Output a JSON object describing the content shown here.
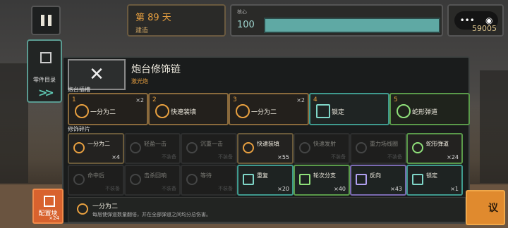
{
  "hud": {
    "day_label": "第 89 天",
    "phase_label": "建造",
    "core_label": "核心",
    "core_value": "100",
    "core_fill": 1.0,
    "coins": "59005"
  },
  "sidebar": {
    "parts_catalog_label": "零件目录",
    "core_block_label": "配置块",
    "core_block_count": "×24"
  },
  "right_button": {
    "label": "议"
  },
  "modal": {
    "title": "炮台修饰链",
    "subtitle": "激光炮",
    "slots_header": "炮台插槽",
    "fragments_header": "修饰碎片",
    "slots": [
      {
        "num": "1",
        "label": "一分为二",
        "count": "×2"
      },
      {
        "num": "2",
        "label": "快速装填",
        "count": ""
      },
      {
        "num": "3",
        "label": "一分为二",
        "count": "×2"
      },
      {
        "num": "4",
        "label": "锁定",
        "count": ""
      },
      {
        "num": "5",
        "label": "蛇形弹道",
        "count": ""
      }
    ],
    "fragments_row1": [
      {
        "label": "一分为二",
        "count": "×4"
      },
      {
        "label": "轻盈一击",
        "count": "不装备"
      },
      {
        "label": "沉重一击",
        "count": "不装备"
      },
      {
        "label": "快速装填",
        "count": "×55"
      },
      {
        "label": "快速发射",
        "count": "不装备"
      },
      {
        "label": "重力场线圈",
        "count": "不装备"
      },
      {
        "label": "蛇形弹道",
        "count": "×24"
      }
    ],
    "fragments_row2": [
      {
        "label": "命中后",
        "count": "不装备"
      },
      {
        "label": "击杀回响",
        "count": "不装备"
      },
      {
        "label": "等待",
        "count": "不装备"
      },
      {
        "label": "重复",
        "count": "×20"
      },
      {
        "label": "轮次分支",
        "count": "×40"
      },
      {
        "label": "反向",
        "count": "×43"
      },
      {
        "label": "锁定",
        "count": "×1"
      }
    ],
    "info": {
      "title": "一分为二",
      "desc": "每层使弹道数量翻倍，并在全部弹道之间均分总伤害。"
    }
  }
}
